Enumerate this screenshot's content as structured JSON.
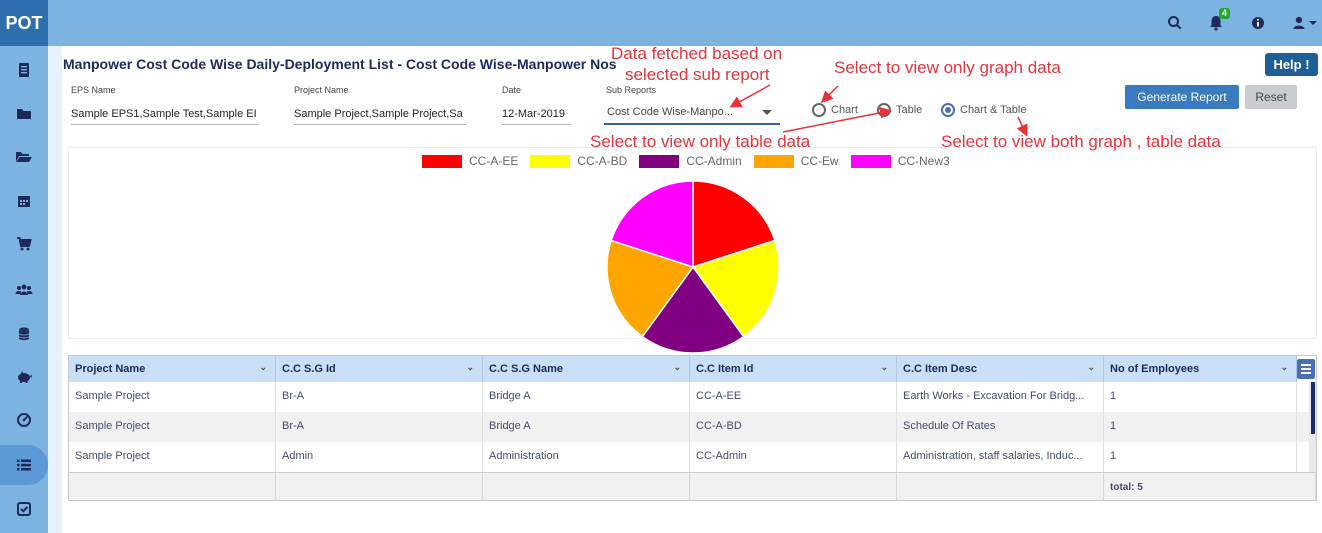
{
  "app": {
    "logo": "POT"
  },
  "topbar": {
    "icons": [
      "search-icon",
      "bell-icon",
      "info-icon",
      "user-icon",
      "caret-down-icon"
    ],
    "notification_count": "4"
  },
  "sidebar": {
    "items": [
      {
        "icon": "document-icon"
      },
      {
        "icon": "folder-icon"
      },
      {
        "icon": "folder-open-icon"
      },
      {
        "icon": "calendar-icon"
      },
      {
        "icon": "cart-icon"
      },
      {
        "icon": "users-icon"
      },
      {
        "icon": "database-icon"
      },
      {
        "icon": "piggy-bank-icon"
      },
      {
        "icon": "dashboard-icon"
      },
      {
        "icon": "list-icon",
        "active": true
      },
      {
        "icon": "check-square-icon"
      }
    ]
  },
  "page": {
    "title": "Manpower Cost Code Wise Daily-Deployment List - Cost Code Wise-Manpower Nos",
    "help_label": "Help !"
  },
  "filters": {
    "eps": {
      "label": "EPS Name",
      "value": "Sample EPS1,Sample Test,Sample EI"
    },
    "project": {
      "label": "Project Name",
      "value": "Sample Project,Sample Project,Sa"
    },
    "date": {
      "label": "Date",
      "value": "12-Mar-2019"
    },
    "sub_reports": {
      "label": "Sub Reports",
      "value": "Cost Code Wise-Manpo..."
    }
  },
  "view_options": {
    "chart": "Chart",
    "table": "Table",
    "both": "Chart & Table",
    "selected": "both"
  },
  "actions": {
    "generate": "Generate Report",
    "reset": "Reset"
  },
  "annotations": {
    "data_fetched_1": "Data fetched based on",
    "data_fetched_2": "selected sub report",
    "graph_only": "Select to view only graph data",
    "table_only": "Select to view only table data",
    "both": "Select to view both graph , table data"
  },
  "colors": {
    "topbar": "#7db3e1",
    "accent": "#3a7bbf",
    "annotation": "#e8333a"
  },
  "chart_data": {
    "type": "pie",
    "title": "",
    "labels": [
      "CC-A-EE",
      "CC-A-BD",
      "CC-Admin",
      "CC-Ew",
      "CC-New3"
    ],
    "values": [
      1,
      1,
      1,
      1,
      1
    ],
    "colors": [
      "#ff0000",
      "#ffff00",
      "#800080",
      "#ffa500",
      "#ff00ff"
    ],
    "legend_position": "top"
  },
  "table": {
    "columns": [
      "Project Name",
      "C.C S.G Id",
      "C.C S.G Name",
      "C.C Item Id",
      "C.C Item Desc",
      "No of Employees"
    ],
    "rows": [
      [
        "Sample Project",
        "Br-A",
        "Bridge A",
        "CC-A-EE",
        "Earth Works - Excavation For Bridg...",
        "1"
      ],
      [
        "Sample Project",
        "Br-A",
        "Bridge A",
        "CC-A-BD",
        "Schedule Of Rates",
        "1"
      ],
      [
        "Sample Project",
        "Admin",
        "Administration",
        "CC-Admin",
        "Administration, staff salaries, Induc...",
        "1"
      ]
    ],
    "footer_total": "total: 5"
  }
}
